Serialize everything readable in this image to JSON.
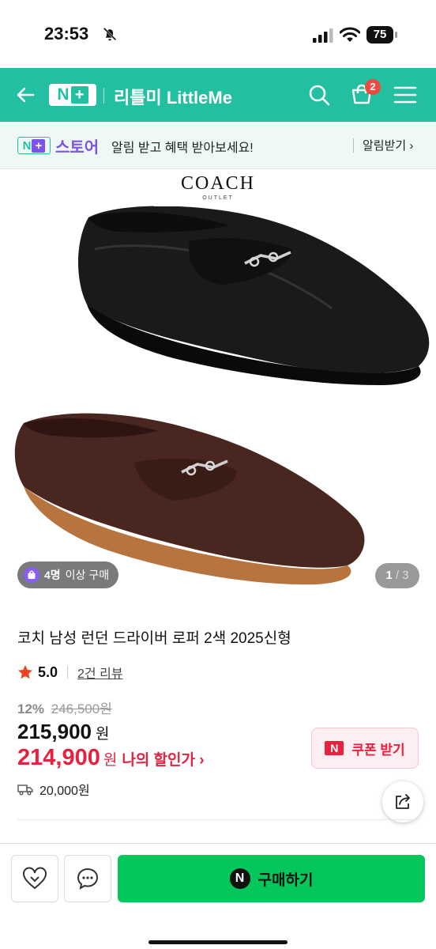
{
  "status_bar": {
    "time": "23:53",
    "battery": "75"
  },
  "header": {
    "store_name": "리틀미 LittleMe",
    "cart_count": "2",
    "logo_n": "N",
    "logo_plus": "+"
  },
  "notice": {
    "store_label": "스토어",
    "text": "알림 받고 혜택 받아보세요!",
    "button": "알림받기 ›"
  },
  "product_image": {
    "brand_word": "COACH",
    "brand_sub": "OUTLET",
    "buyer_chip": {
      "count": "4명",
      "suffix": "이상 구매"
    },
    "counter": {
      "current": "1",
      "total": "/ 3"
    },
    "colors": {
      "shoe1": "#1a1a1a",
      "shoe2": "#4a2620",
      "sole2": "#b8743e"
    }
  },
  "product": {
    "title": "코치 남성 런던 드라이버 로퍼 2색 2025신형",
    "rating": "5.0",
    "reviews": "2건 리뷰",
    "discount_rate": "12%",
    "original_price": "246,500원",
    "sale_price": "215,900",
    "won": "원",
    "my_price": "214,900",
    "my_price_label": "나의 할인가 ›",
    "coupon_label": "쿠폰 받기",
    "coupon_n": "N",
    "shipping": "20,000원"
  },
  "bottom_bar": {
    "buy_label": "구매하기",
    "npay": "N"
  },
  "icons": [
    "back-arrow-icon",
    "search-icon",
    "cart-icon",
    "menu-icon",
    "bell-off-icon",
    "signal-icon",
    "wifi-icon",
    "star-icon",
    "truck-icon",
    "share-icon",
    "heart-icon",
    "chat-icon",
    "bag-icon"
  ],
  "colors": {
    "brand_green": "#22c0a0",
    "naver_green": "#03c75a",
    "sale_red": "#e8213f",
    "store_purple": "#7c52e8"
  }
}
